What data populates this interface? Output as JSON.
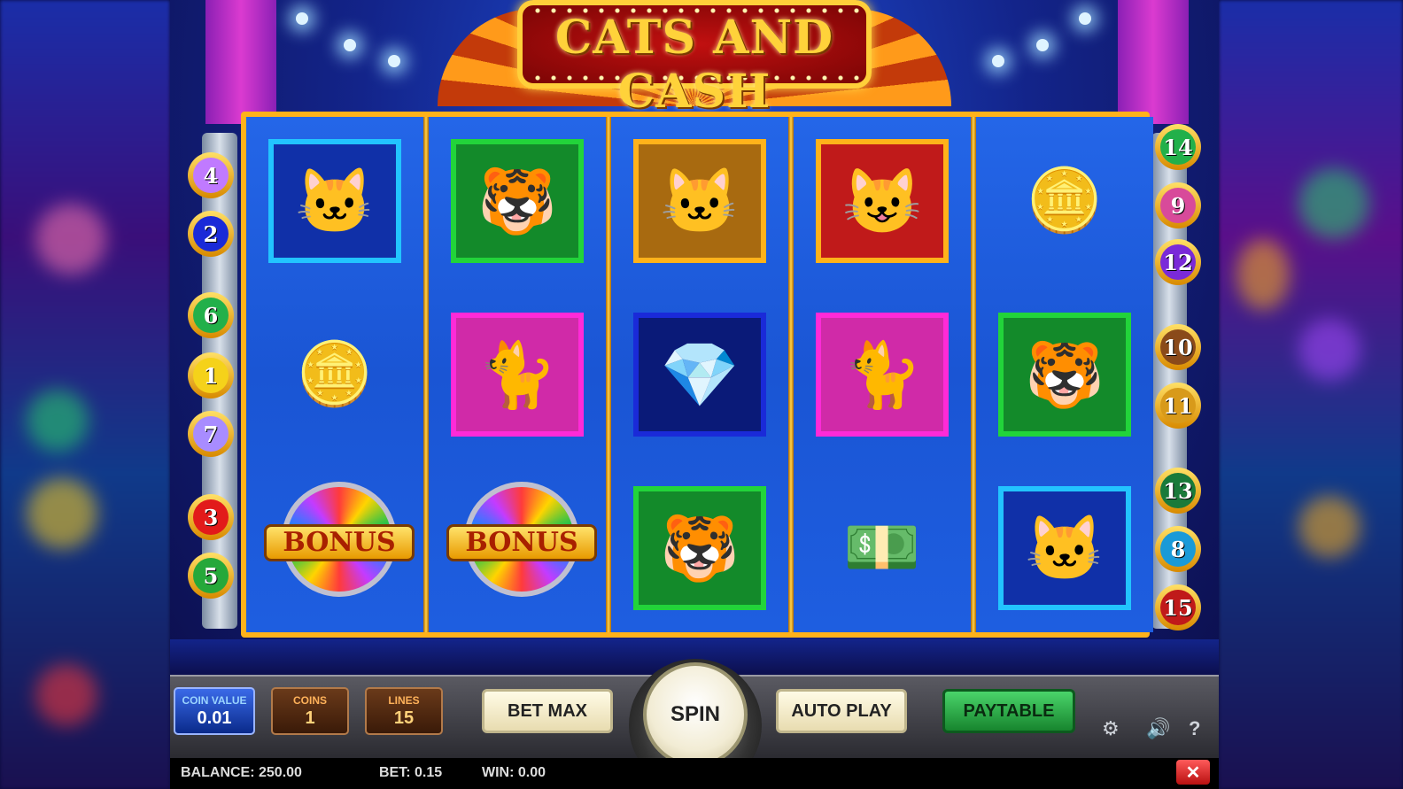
{
  "game_title": "CATS AND CASH",
  "paylines_left": [
    {
      "num": "4",
      "color": "#c07aff"
    },
    {
      "num": "2",
      "color": "#1a2ad8"
    },
    {
      "num": "6",
      "color": "#22b04a"
    },
    {
      "num": "1",
      "color": "#f5d21a"
    },
    {
      "num": "7",
      "color": "#a88cff"
    },
    {
      "num": "3",
      "color": "#e21a1a"
    },
    {
      "num": "5",
      "color": "#26a83a"
    }
  ],
  "paylines_right": [
    {
      "num": "14",
      "color": "#22b04a"
    },
    {
      "num": "9",
      "color": "#d84a9a"
    },
    {
      "num": "12",
      "color": "#7a2ad8"
    },
    {
      "num": "10",
      "color": "#8a4a1a"
    },
    {
      "num": "11",
      "color": "#d89a1a"
    },
    {
      "num": "13",
      "color": "#1a7a3a"
    },
    {
      "num": "8",
      "color": "#1a9ad8"
    },
    {
      "num": "15",
      "color": "#c01a1a"
    }
  ],
  "reels": [
    [
      {
        "kind": "cat",
        "icon": "cat-lady-red-dress-icon",
        "glyph": "🐱",
        "border": "#22c4ff",
        "bg": "#1030a8"
      },
      {
        "kind": "gold",
        "icon": "gold-bars-icon",
        "glyph": "🪙"
      },
      {
        "kind": "bonus",
        "icon": "bonus-wheel-icon",
        "text": "BONUS"
      }
    ],
    [
      {
        "kind": "cat",
        "icon": "tiger-cat-suit-icon",
        "glyph": "🐯",
        "border": "#22d43a",
        "bg": "#138a2a"
      },
      {
        "kind": "cat",
        "icon": "persian-cat-pink-fur-icon",
        "glyph": "🐈",
        "border": "#ff2ad8",
        "bg": "#d02aa8"
      },
      {
        "kind": "bonus",
        "icon": "bonus-wheel-icon",
        "text": "BONUS"
      }
    ],
    [
      {
        "kind": "cat",
        "icon": "gray-cat-gentleman-icon",
        "glyph": "🐱",
        "border": "#ffb21a",
        "bg": "#a86a10"
      },
      {
        "kind": "cat",
        "icon": "diamond-necklace-icon",
        "glyph": "💎",
        "border": "#1a2ad8",
        "bg": "#0a1a78"
      },
      {
        "kind": "cat",
        "icon": "tiger-cat-suit-icon",
        "glyph": "🐯",
        "border": "#22d43a",
        "bg": "#138a2a"
      }
    ],
    [
      {
        "kind": "cat",
        "icon": "singer-cat-microphone-icon",
        "glyph": "😺",
        "border": "#ffb21a",
        "bg": "#c01a1a"
      },
      {
        "kind": "cat",
        "icon": "persian-cat-pink-fur-icon",
        "glyph": "🐈",
        "border": "#ff2ad8",
        "bg": "#d02aa8"
      },
      {
        "kind": "gold",
        "icon": "cash-stacks-icon",
        "glyph": "💵"
      }
    ],
    [
      {
        "kind": "gold",
        "icon": "gold-bars-icon",
        "glyph": "🪙"
      },
      {
        "kind": "cat",
        "icon": "tiger-cat-suit-icon",
        "glyph": "🐯",
        "border": "#22d43a",
        "bg": "#138a2a"
      },
      {
        "kind": "cat",
        "icon": "cat-lady-red-dress-icon",
        "glyph": "🐱",
        "border": "#22c4ff",
        "bg": "#1030a8"
      }
    ]
  ],
  "controls": {
    "coin_value_label": "COIN VALUE",
    "coin_value": "0.01",
    "coins_label": "COINS",
    "coins": "1",
    "lines_label": "LINES",
    "lines": "15",
    "bet_max": "BET MAX",
    "spin": "SPIN",
    "auto_play": "AUTO PLAY",
    "paytable": "PAYTABLE"
  },
  "status": {
    "balance": "BALANCE: 250.00",
    "bet": "BET: 0.15",
    "win": "WIN: 0.00"
  },
  "icons": {
    "settings": "⚙",
    "sound": "🔊",
    "help": "?",
    "close": "✕"
  }
}
